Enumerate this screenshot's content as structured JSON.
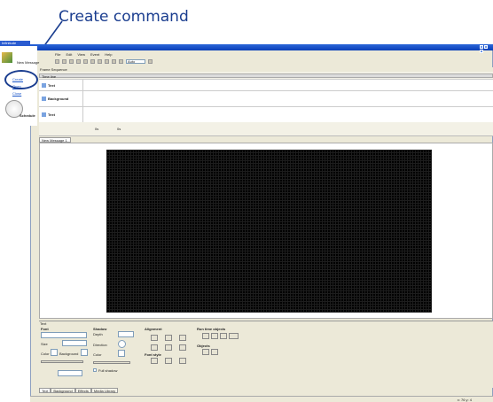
{
  "callout": {
    "text": "Create command"
  },
  "window": {
    "logo_title": "Infinitude"
  },
  "menu": {
    "items": [
      "File",
      "Edit",
      "View",
      "Event",
      "Help"
    ]
  },
  "toolbar": {
    "zoom_value": "Auto"
  },
  "sidebar": {
    "new_message_label": "New Message",
    "create_link": "Create",
    "open_link": "Open",
    "close_link": "Close",
    "schedule_label": "Schedule"
  },
  "frame_sequence": {
    "header": "Frame Sequence",
    "ruler_label": "Time line",
    "rows": [
      "Text",
      "Background",
      "Text"
    ],
    "footer_labels": [
      "0s",
      "0s"
    ]
  },
  "message_tab": {
    "label": "New Message 1"
  },
  "text_panel": {
    "header": "Text",
    "font": {
      "title": "Font",
      "size_label": "Size",
      "color_label": "Color",
      "background_label": "Background"
    },
    "shadow": {
      "title": "Shadow",
      "depth_label": "Depth",
      "direction_label": "Direction",
      "color_label": "Color",
      "full_shadow_label": "Full shadow"
    },
    "alignment": {
      "title": "Alignment",
      "font_style_title": "Font style"
    },
    "runtime": {
      "title": "Run time objects",
      "objects_title": "Objects"
    }
  },
  "bottom_tabs": [
    "Text",
    "Background",
    "Effects",
    "Media Library"
  ],
  "status": {
    "text": "x: 76 y: 4"
  },
  "colors": {
    "titlebar": "#0b3fb8",
    "callout": "#1a3d8f",
    "led": "#000000"
  }
}
